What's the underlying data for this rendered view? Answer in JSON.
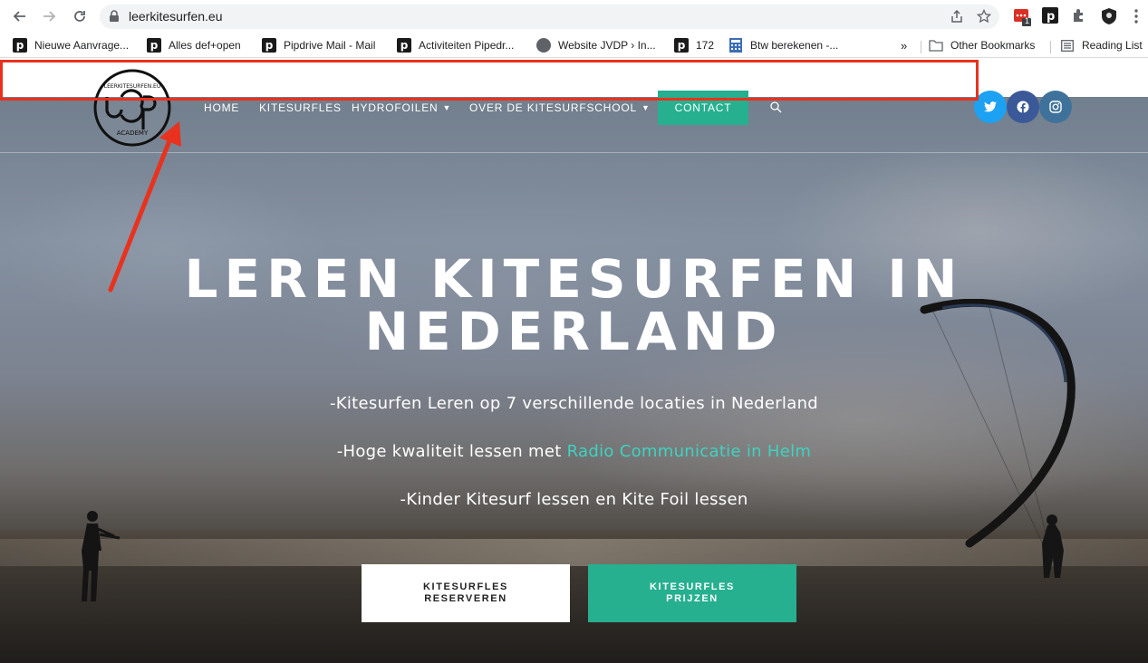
{
  "browser": {
    "url": "leerkitesurfen.eu",
    "extension_badge": "1",
    "bookmarks": [
      {
        "label": "Nieuwe Aanvrage...",
        "icon": "pipedrive-icon"
      },
      {
        "label": "Alles def+open",
        "icon": "pipedrive-icon"
      },
      {
        "label": "Pipdrive Mail - Mail",
        "icon": "pipedrive-icon"
      },
      {
        "label": "Activiteiten Pipedr...",
        "icon": "pipedrive-icon"
      },
      {
        "label": "Website JVDP › In...",
        "icon": "globe-icon"
      },
      {
        "label": "172",
        "icon": "pipedrive-icon"
      },
      {
        "label": "Btw berekenen -...",
        "icon": "calculator-icon"
      }
    ],
    "overflow": "»",
    "other_bookmarks": "Other Bookmarks",
    "reading_list": "Reading List"
  },
  "site": {
    "logo": {
      "top_text": "LEERKITESURFEN.EU",
      "initials": "JvdP",
      "sub_text": "ACADEMY"
    },
    "menu": {
      "home": "HOME",
      "kitesurfles": "KITESURFLES",
      "hydrofoilen": "HYDROFOILEN",
      "over": "OVER DE KITESURFSCHOOL",
      "contact": "CONTACT"
    },
    "social": [
      {
        "name": "twitter",
        "color": "#1da1f2"
      },
      {
        "name": "facebook",
        "color": "#3b5998"
      },
      {
        "name": "instagram",
        "color": "#3f729b"
      }
    ],
    "hero": {
      "title_line1": "LEREN KITESURFEN IN",
      "title_line2": "NEDERLAND",
      "line1": "-Kitesurfen Leren op 7 verschillende locaties in Nederland",
      "line2_prefix": "-Hoge kwaliteit lessen met ",
      "line2_link": "Radio Communicatie in Helm",
      "line3": "-Kinder Kitesurf lessen en Kite Foil lessen",
      "cta_reserve_line1": "KITESURFLES",
      "cta_reserve_line2": "RESERVEREN",
      "cta_prices_line1": "KITESURFLES",
      "cta_prices_line2": "PRIJZEN"
    }
  },
  "colors": {
    "accent": "#26b08f",
    "link": "#3dd3c0",
    "annotation": "#e8321e"
  }
}
